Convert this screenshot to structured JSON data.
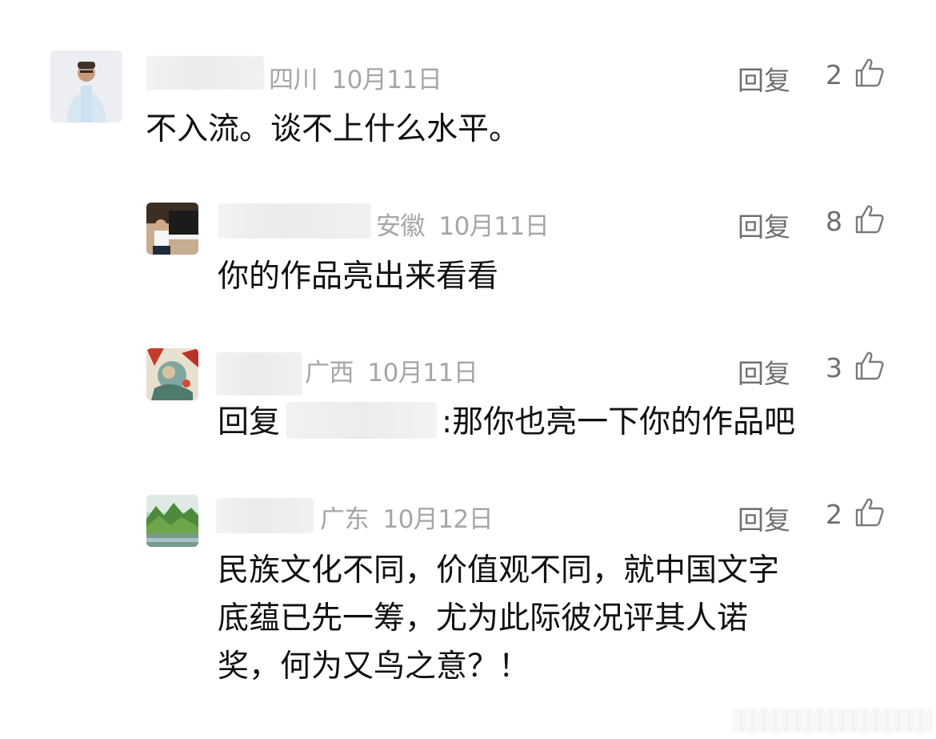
{
  "reply_label": "回复",
  "comments": [
    {
      "region": "四川",
      "date": "10月11日",
      "likes": "2",
      "text": "不入流。谈不上什么水平。"
    },
    {
      "region": "安徽",
      "date": "10月11日",
      "likes": "8",
      "text": "你的作品亮出来看看"
    },
    {
      "region": "广西",
      "date": "10月11日",
      "likes": "3",
      "reply_prefix": "回复",
      "text": ":那你也亮一下你的作品吧"
    },
    {
      "region": "广东",
      "date": "10月12日",
      "likes": "2",
      "lines": [
        "民族文化不同，价值观不同，就中国文字",
        "底蕴已先一筹，尤为此际彼况评其人诺",
        "奖，何为又鸟之意？！"
      ]
    }
  ]
}
